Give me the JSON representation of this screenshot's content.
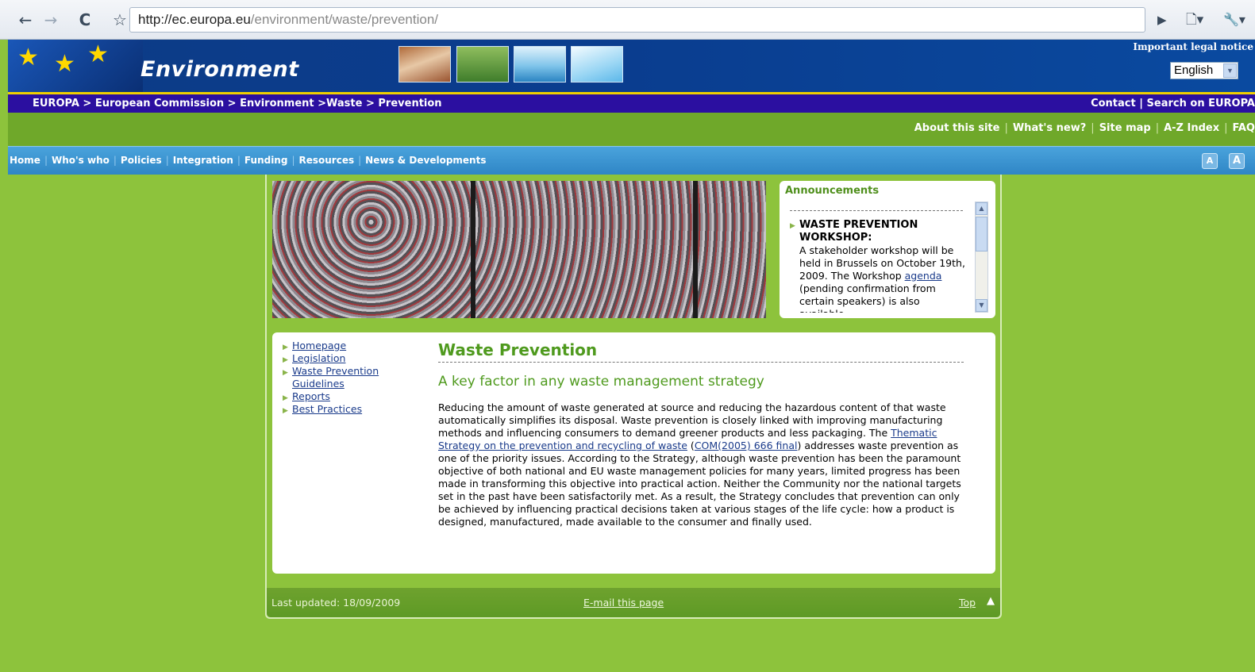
{
  "browser": {
    "url_domain": "http://ec.europa.eu",
    "url_path": "/environment/waste/prevention/",
    "back_icon": "←",
    "forward_icon": "→",
    "reload_icon": "C",
    "star_icon": "☆",
    "play_icon": "▶",
    "page_icon": "🗋▾",
    "wrench_icon": "🔧▾"
  },
  "header": {
    "site_title": "Environment",
    "legal_notice": "Important legal notice",
    "language": "English",
    "star_glyph": "★"
  },
  "breadcrumb": {
    "items": [
      "EUROPA",
      "European Commission",
      "Environment",
      "Waste",
      "Prevention"
    ],
    "separators": [
      " > ",
      " > ",
      " >",
      " > "
    ],
    "contact": "Contact",
    "search": "Search on EUROPA",
    "sep": " | "
  },
  "util_links": [
    "About this site",
    "What's new?",
    "Site map",
    "A-Z Index",
    "FAQ"
  ],
  "main_nav": [
    "Home",
    "Who's who",
    "Policies",
    "Integration",
    "Funding",
    "Resources",
    "News & Developments"
  ],
  "font_buttons": [
    "A",
    "A"
  ],
  "announcements": {
    "title": "Announcements",
    "headline": "WASTE PREVENTION WORKSHOP:",
    "text_before": "A stakeholder workshop will be held in Brussels on October 19th, 2009. The Workshop ",
    "link": "agenda",
    "text_after": " (pending confirmation from certain speakers) is also available."
  },
  "left_menu": [
    "Homepage",
    "Legislation",
    "Waste Prevention Guidelines",
    "Reports",
    "Best Practices"
  ],
  "content": {
    "title": "Waste Prevention",
    "subtitle": "A key factor in any waste management strategy",
    "para_1": "Reducing the amount of waste generated at source and reducing the hazardous content of that waste automatically simplifies its disposal. Waste prevention is closely linked with improving manufacturing methods and influencing consumers to demand greener products and less packaging. The ",
    "link_1": "Thematic Strategy on the prevention and recycling of waste",
    "para_2": " (",
    "link_2": "COM(2005) 666 final",
    "para_3": ") addresses waste prevention as one of the priority issues. According to the Strategy, although waste prevention has been the paramount objective of both national and EU waste management policies for many years, limited progress has been made in transforming this objective into practical action. Neither the Community nor the national targets set in the past have been satisfactorily met. As a result, the Strategy concludes that prevention can only be achieved by influencing practical decisions taken at various stages of the life cycle: how a product is designed, manufactured, made available to the consumer and finally used."
  },
  "footer": {
    "last_updated": "Last updated: 18/09/2009",
    "email": "E-mail this page",
    "top": "Top",
    "top_arrow": "▲"
  },
  "colors": {
    "page_green": "#8dc33c",
    "header_blue": "#0a3d8f",
    "crumb_purple": "#2b0fa0",
    "util_green": "#6fa82a",
    "nav_blue": "#2f86c6",
    "title_green": "#4f9a1e",
    "link_blue": "#1a3b8b"
  }
}
